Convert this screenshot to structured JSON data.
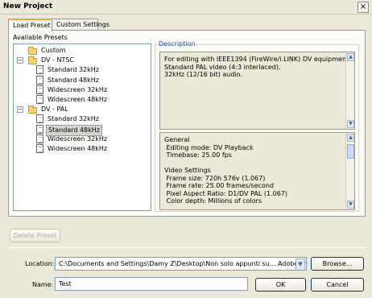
{
  "window": {
    "title": "New Project",
    "close_glyph": "×"
  },
  "tabs": [
    {
      "label": "Load Preset"
    },
    {
      "label": "Custom Settings"
    }
  ],
  "available_presets": {
    "label": "Available Presets",
    "items": [
      {
        "type": "folder",
        "label": "Custom",
        "level": 0
      },
      {
        "type": "folder",
        "label": "DV - NTSC",
        "level": 0,
        "expanded": true
      },
      {
        "type": "preset",
        "label": "Standard 32kHz",
        "level": 1
      },
      {
        "type": "preset",
        "label": "Standard 48kHz",
        "level": 1
      },
      {
        "type": "preset",
        "label": "Widescreen 32kHz",
        "level": 1
      },
      {
        "type": "preset",
        "label": "Widescreen 48kHz",
        "level": 1
      },
      {
        "type": "folder",
        "label": "DV - PAL",
        "level": 0,
        "expanded": true
      },
      {
        "type": "preset",
        "label": "Standard 32kHz",
        "level": 1
      },
      {
        "type": "preset",
        "label": "Standard 48kHz",
        "level": 1,
        "selected": true
      },
      {
        "type": "preset",
        "label": "Widescreen 32kHz",
        "level": 1
      },
      {
        "type": "preset",
        "label": "Widescreen 48kHz",
        "level": 1
      }
    ]
  },
  "description": {
    "label": "Description",
    "text": [
      "For editing with IEEE1394 (FireWire/i.LINK) DV equipment.",
      "Standard PAL video (4:3 interlaced).",
      "32kHz (12/16 bit) audio."
    ]
  },
  "details": {
    "text": [
      "General",
      " Editing mode: DV Playback",
      " Timebase: 25.00 fps",
      "",
      "Video Settings",
      " Frame size: 720h 576v (1.067)",
      " Frame rate: 25.00 frames/second",
      " Pixel Aspect Ratio: D1/DV PAL (1.067)",
      " Color depth: Millions of colors"
    ]
  },
  "buttons": {
    "delete_preset": "Delete Preset",
    "browse": "Browse...",
    "ok": "OK",
    "cancel": "Cancel"
  },
  "location": {
    "label": "Location:",
    "value": "C:\\Documents and Settings\\Damy Z\\Desktop\\Non solo appunti su... Adobe Premiere Pro"
  },
  "name": {
    "label": "Name:",
    "value": "Test"
  },
  "colors": {
    "accent": "#f3a53b",
    "selection": "#d6d3ce",
    "link": "#1f4ea3"
  },
  "icons": {
    "folder": "folder-icon",
    "preset": "preset-file-icon",
    "scroll_up": "▲",
    "scroll_down": "▼",
    "dropdown": "▼",
    "collapse": "−"
  }
}
